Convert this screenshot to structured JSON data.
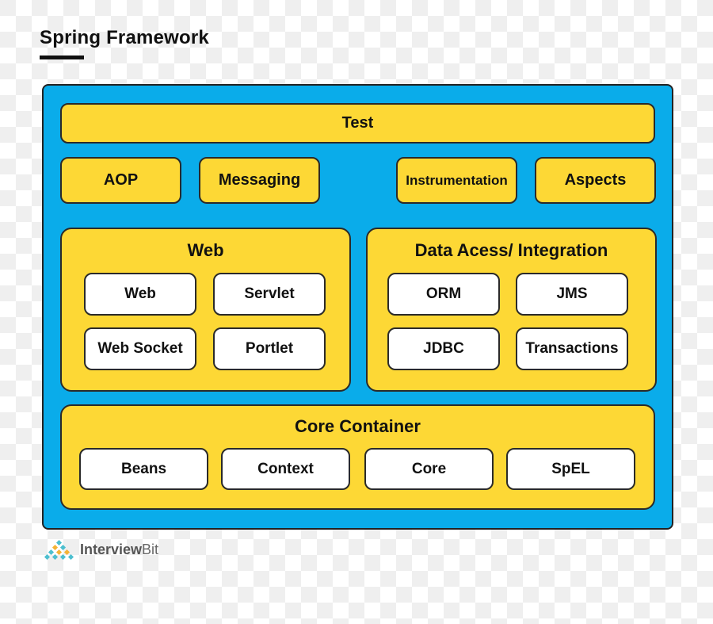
{
  "title": "Spring Framework",
  "colors": {
    "frame": "#0aacea",
    "module": "#fdd835",
    "submodule": "#ffffff",
    "border": "#2a2a2a"
  },
  "modules": {
    "test": "Test",
    "aop": "AOP",
    "messaging": "Messaging",
    "instrumentation": "Instrumentation",
    "aspects": "Aspects"
  },
  "web": {
    "title": "Web",
    "items": [
      "Web",
      "Servlet",
      "Web Socket",
      "Portlet"
    ]
  },
  "data_access": {
    "title": "Data Acess/ Integration",
    "items": [
      "ORM",
      "JMS",
      "JDBC",
      "Transactions"
    ]
  },
  "core_container": {
    "title": "Core Container",
    "items": [
      "Beans",
      "Context",
      "Core",
      "SpEL"
    ]
  },
  "logo": {
    "brand_bold": "Interview",
    "brand_light": "Bit",
    "icon": "triangle-of-diamonds-logo-icon"
  }
}
